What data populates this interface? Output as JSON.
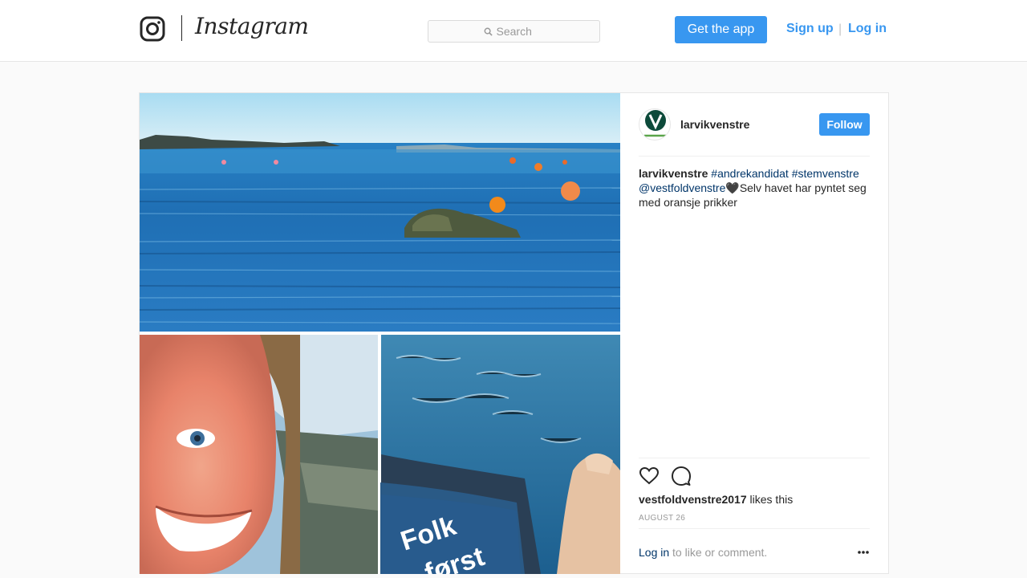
{
  "nav": {
    "logo_text": "Instagram",
    "search_placeholder": "Search",
    "get_app_label": "Get the app",
    "signup_label": "Sign up",
    "separator": "|",
    "login_label": "Log in"
  },
  "post": {
    "username": "larvikvenstre",
    "follow_label": "Follow",
    "caption": {
      "user": "larvikvenstre",
      "hashtag1": "#andrekandidat",
      "hashtag2": "#stemvenstre",
      "mention": "@vestfoldvenstre",
      "heart": "🖤",
      "text": "Selv havet har pyntet seg med oransje prikker"
    },
    "likes": {
      "liker": "vestfoldvenstre2017",
      "suffix": " likes this"
    },
    "date": "AUGUST 26",
    "login_prompt": {
      "link": "Log in",
      "rest": " to like or comment."
    },
    "photo_text": "Folk først"
  },
  "colors": {
    "accent": "#3897f0",
    "link": "#003569",
    "muted": "#999999"
  },
  "icons": [
    "instagram-camera-icon",
    "search-icon",
    "heart-icon",
    "comment-icon",
    "more-options-icon"
  ]
}
